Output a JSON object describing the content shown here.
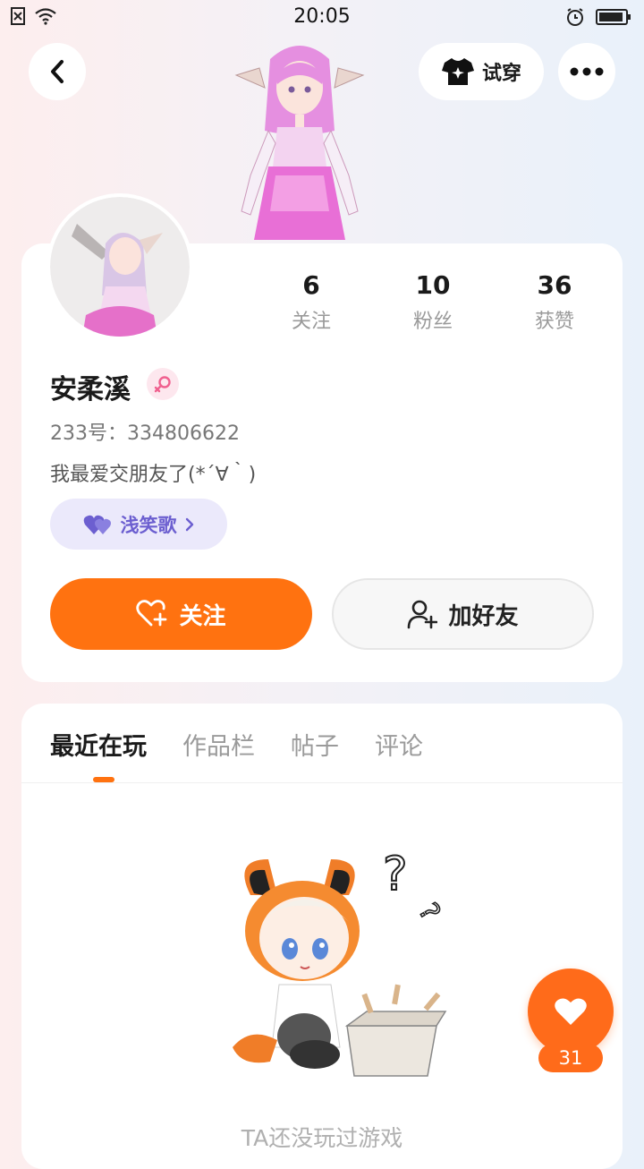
{
  "status_bar": {
    "time": "20:05"
  },
  "header": {
    "tryon_label": "试穿"
  },
  "profile": {
    "stats": [
      {
        "value": "6",
        "label": "关注"
      },
      {
        "value": "10",
        "label": "粉丝"
      },
      {
        "value": "36",
        "label": "获赞"
      }
    ],
    "name": "安柔溪",
    "uid": "233号：334806622",
    "bio": "我最爱交朋友了(*´∀｀)",
    "tag_label": "浅笑歌",
    "follow_label": "关注",
    "add_friend_label": "加好友"
  },
  "tabs": [
    {
      "label": "最近在玩"
    },
    {
      "label": "作品栏"
    },
    {
      "label": "帖子"
    },
    {
      "label": "评论"
    }
  ],
  "empty_state": {
    "text": "TA还没玩过游戏"
  },
  "like_fab": {
    "count": "31"
  },
  "colors": {
    "accent": "#ff7210",
    "tag_text": "#6c5fd0",
    "tag_bg": "#ebe9fb"
  }
}
